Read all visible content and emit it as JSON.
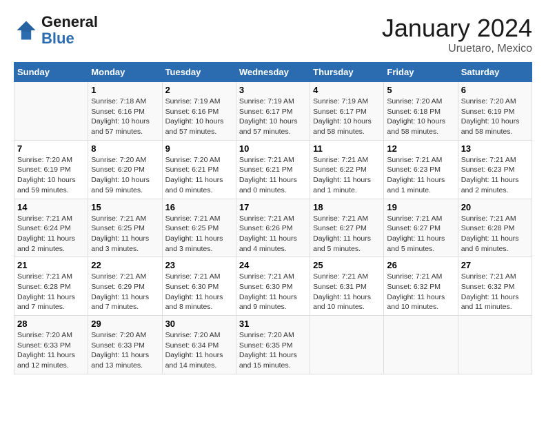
{
  "header": {
    "logo": {
      "general": "General",
      "blue": "Blue"
    },
    "title": "January 2024",
    "location": "Uruetaro, Mexico"
  },
  "days_of_week": [
    "Sunday",
    "Monday",
    "Tuesday",
    "Wednesday",
    "Thursday",
    "Friday",
    "Saturday"
  ],
  "weeks": [
    [
      {
        "day": "",
        "info": ""
      },
      {
        "day": "1",
        "info": "Sunrise: 7:18 AM\nSunset: 6:16 PM\nDaylight: 10 hours\nand 57 minutes."
      },
      {
        "day": "2",
        "info": "Sunrise: 7:19 AM\nSunset: 6:16 PM\nDaylight: 10 hours\nand 57 minutes."
      },
      {
        "day": "3",
        "info": "Sunrise: 7:19 AM\nSunset: 6:17 PM\nDaylight: 10 hours\nand 57 minutes."
      },
      {
        "day": "4",
        "info": "Sunrise: 7:19 AM\nSunset: 6:17 PM\nDaylight: 10 hours\nand 58 minutes."
      },
      {
        "day": "5",
        "info": "Sunrise: 7:20 AM\nSunset: 6:18 PM\nDaylight: 10 hours\nand 58 minutes."
      },
      {
        "day": "6",
        "info": "Sunrise: 7:20 AM\nSunset: 6:19 PM\nDaylight: 10 hours\nand 58 minutes."
      }
    ],
    [
      {
        "day": "7",
        "info": "Sunrise: 7:20 AM\nSunset: 6:19 PM\nDaylight: 10 hours\nand 59 minutes."
      },
      {
        "day": "8",
        "info": "Sunrise: 7:20 AM\nSunset: 6:20 PM\nDaylight: 10 hours\nand 59 minutes."
      },
      {
        "day": "9",
        "info": "Sunrise: 7:20 AM\nSunset: 6:21 PM\nDaylight: 11 hours\nand 0 minutes."
      },
      {
        "day": "10",
        "info": "Sunrise: 7:21 AM\nSunset: 6:21 PM\nDaylight: 11 hours\nand 0 minutes."
      },
      {
        "day": "11",
        "info": "Sunrise: 7:21 AM\nSunset: 6:22 PM\nDaylight: 11 hours\nand 1 minute."
      },
      {
        "day": "12",
        "info": "Sunrise: 7:21 AM\nSunset: 6:23 PM\nDaylight: 11 hours\nand 1 minute."
      },
      {
        "day": "13",
        "info": "Sunrise: 7:21 AM\nSunset: 6:23 PM\nDaylight: 11 hours\nand 2 minutes."
      }
    ],
    [
      {
        "day": "14",
        "info": "Sunrise: 7:21 AM\nSunset: 6:24 PM\nDaylight: 11 hours\nand 2 minutes."
      },
      {
        "day": "15",
        "info": "Sunrise: 7:21 AM\nSunset: 6:25 PM\nDaylight: 11 hours\nand 3 minutes."
      },
      {
        "day": "16",
        "info": "Sunrise: 7:21 AM\nSunset: 6:25 PM\nDaylight: 11 hours\nand 3 minutes."
      },
      {
        "day": "17",
        "info": "Sunrise: 7:21 AM\nSunset: 6:26 PM\nDaylight: 11 hours\nand 4 minutes."
      },
      {
        "day": "18",
        "info": "Sunrise: 7:21 AM\nSunset: 6:27 PM\nDaylight: 11 hours\nand 5 minutes."
      },
      {
        "day": "19",
        "info": "Sunrise: 7:21 AM\nSunset: 6:27 PM\nDaylight: 11 hours\nand 5 minutes."
      },
      {
        "day": "20",
        "info": "Sunrise: 7:21 AM\nSunset: 6:28 PM\nDaylight: 11 hours\nand 6 minutes."
      }
    ],
    [
      {
        "day": "21",
        "info": "Sunrise: 7:21 AM\nSunset: 6:28 PM\nDaylight: 11 hours\nand 7 minutes."
      },
      {
        "day": "22",
        "info": "Sunrise: 7:21 AM\nSunset: 6:29 PM\nDaylight: 11 hours\nand 7 minutes."
      },
      {
        "day": "23",
        "info": "Sunrise: 7:21 AM\nSunset: 6:30 PM\nDaylight: 11 hours\nand 8 minutes."
      },
      {
        "day": "24",
        "info": "Sunrise: 7:21 AM\nSunset: 6:30 PM\nDaylight: 11 hours\nand 9 minutes."
      },
      {
        "day": "25",
        "info": "Sunrise: 7:21 AM\nSunset: 6:31 PM\nDaylight: 11 hours\nand 10 minutes."
      },
      {
        "day": "26",
        "info": "Sunrise: 7:21 AM\nSunset: 6:32 PM\nDaylight: 11 hours\nand 10 minutes."
      },
      {
        "day": "27",
        "info": "Sunrise: 7:21 AM\nSunset: 6:32 PM\nDaylight: 11 hours\nand 11 minutes."
      }
    ],
    [
      {
        "day": "28",
        "info": "Sunrise: 7:20 AM\nSunset: 6:33 PM\nDaylight: 11 hours\nand 12 minutes."
      },
      {
        "day": "29",
        "info": "Sunrise: 7:20 AM\nSunset: 6:33 PM\nDaylight: 11 hours\nand 13 minutes."
      },
      {
        "day": "30",
        "info": "Sunrise: 7:20 AM\nSunset: 6:34 PM\nDaylight: 11 hours\nand 14 minutes."
      },
      {
        "day": "31",
        "info": "Sunrise: 7:20 AM\nSunset: 6:35 PM\nDaylight: 11 hours\nand 15 minutes."
      },
      {
        "day": "",
        "info": ""
      },
      {
        "day": "",
        "info": ""
      },
      {
        "day": "",
        "info": ""
      }
    ]
  ]
}
